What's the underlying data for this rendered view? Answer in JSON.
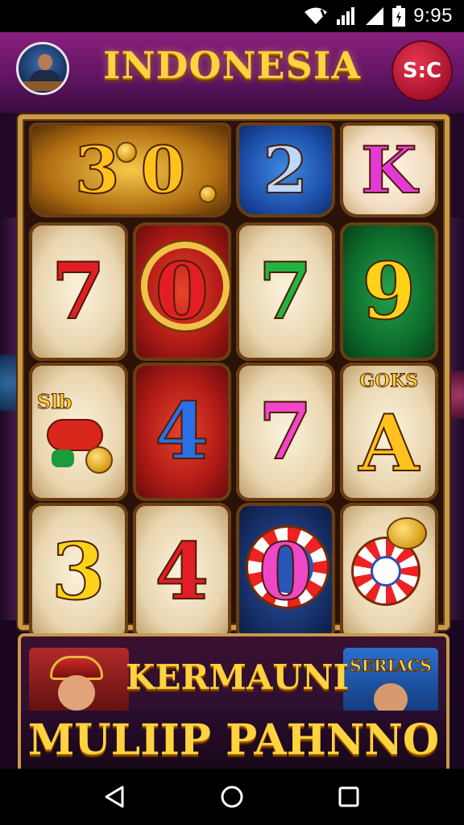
{
  "status_bar": {
    "time": "9:95",
    "icons": [
      "wifi-icon",
      "signal-icon",
      "signal-icon-2",
      "battery-icon"
    ]
  },
  "header": {
    "title": "INDONESIA",
    "logo_text": "S:C",
    "avatar_icon": "presenter-avatar"
  },
  "reels": {
    "row1": [
      {
        "symbol": "3",
        "style": "gold",
        "extra_symbol": "0"
      },
      {
        "symbol": "2",
        "style": "blue"
      },
      {
        "symbol": "K",
        "style": "pink"
      }
    ],
    "row2": [
      {
        "symbol": "7",
        "style": "ivory-red"
      },
      {
        "symbol": "0",
        "style": "red"
      },
      {
        "symbol": "7",
        "style": "ivory-green"
      },
      {
        "symbol": "9",
        "style": "green"
      }
    ],
    "row3": [
      {
        "symbol": "Slb",
        "style": "ivory-candy"
      },
      {
        "symbol": "4",
        "style": "red-blue"
      },
      {
        "symbol": "7",
        "style": "ivory-magenta"
      },
      {
        "symbol": "A",
        "style": "ivory-gold",
        "tag": "GOKS"
      }
    ],
    "row4": [
      {
        "symbol": "3",
        "style": "ivory-yellow"
      },
      {
        "symbol": "4",
        "style": "ivory-red"
      },
      {
        "symbol": "0",
        "style": "navy-pink"
      },
      {
        "symbol": "",
        "style": "chips"
      }
    ]
  },
  "banner": {
    "line1": "KERMAUNI",
    "line2": "MULIIP PAHNNO",
    "right_label": "SERIACS"
  },
  "nav": {
    "back_icon": "back-triangle-icon",
    "home_icon": "home-circle-icon",
    "recents_icon": "recents-square-icon"
  }
}
